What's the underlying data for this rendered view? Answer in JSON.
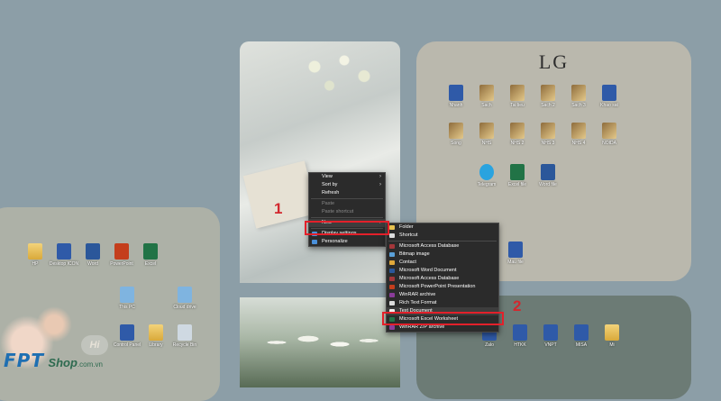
{
  "lg_panel": {
    "title": "LG"
  },
  "desktop_left": {
    "icons": [
      {
        "label": "HP",
        "type": "folder"
      },
      {
        "label": "Desktop ICON",
        "type": "app"
      },
      {
        "label": "Word",
        "type": "word"
      },
      {
        "label": "PowerPoint",
        "type": "ppt"
      },
      {
        "label": "Excel",
        "type": "excel"
      },
      {
        "label": "This PC",
        "type": "pc"
      },
      {
        "label": "Cloud drive",
        "type": "pc"
      },
      {
        "label": "Control Panel",
        "type": "app"
      },
      {
        "label": "Library",
        "type": "folder"
      },
      {
        "label": "Recycle Bin",
        "type": "bin"
      }
    ]
  },
  "desktop_lg": {
    "icons": [
      {
        "label": "Nhanh",
        "type": "app"
      },
      {
        "label": "Sach",
        "type": "book"
      },
      {
        "label": "Tai lieu",
        "type": "book"
      },
      {
        "label": "Sach 2",
        "type": "book"
      },
      {
        "label": "Sach 3",
        "type": "book"
      },
      {
        "label": "Khao sat",
        "type": "app"
      },
      {
        "label": "Song",
        "type": "book"
      },
      {
        "label": "NHS",
        "type": "book"
      },
      {
        "label": "NHS 2",
        "type": "book"
      },
      {
        "label": "NHS 3",
        "type": "book"
      },
      {
        "label": "NHS 4",
        "type": "book"
      },
      {
        "label": "NOIDA",
        "type": "book"
      },
      {
        "label": "Telegram",
        "type": "tg"
      },
      {
        "label": "Excel file",
        "type": "excel"
      },
      {
        "label": "Word file",
        "type": "word"
      },
      {
        "label": "Mau file",
        "type": "app"
      }
    ]
  },
  "desktop_br": {
    "icons": [
      {
        "label": "Zalo",
        "type": "app"
      },
      {
        "label": "HTKK",
        "type": "app"
      },
      {
        "label": "VNPT",
        "type": "app"
      },
      {
        "label": "MISA",
        "type": "app"
      },
      {
        "label": "Mi",
        "type": "folder"
      }
    ]
  },
  "context_menu": {
    "items": [
      {
        "label": "View",
        "icon": "",
        "submenu": true,
        "disabled": false
      },
      {
        "label": "Sort by",
        "icon": "",
        "submenu": true,
        "disabled": false
      },
      {
        "label": "Refresh",
        "icon": "",
        "submenu": false,
        "disabled": false
      },
      {
        "label": "Paste",
        "icon": "",
        "submenu": false,
        "disabled": true
      },
      {
        "label": "Paste shortcut",
        "icon": "",
        "submenu": false,
        "disabled": true
      },
      {
        "label": "New",
        "icon": "",
        "submenu": true,
        "disabled": false
      },
      {
        "label": "Display settings",
        "icon": "display-icon",
        "submenu": false,
        "disabled": false
      },
      {
        "label": "Personalize",
        "icon": "personalize-icon",
        "submenu": false,
        "disabled": false
      }
    ]
  },
  "submenu_new": {
    "items": [
      {
        "label": "Folder",
        "icon": "folder-icon",
        "color": "#e8c14f"
      },
      {
        "label": "Shortcut",
        "icon": "shortcut-icon",
        "color": "#dcdcdc"
      },
      {
        "label": "Microsoft Access Database",
        "icon": "access-icon",
        "color": "#a4373a"
      },
      {
        "label": "Bitmap image",
        "icon": "bitmap-icon",
        "color": "#5aa0d8"
      },
      {
        "label": "Contact",
        "icon": "contact-icon",
        "color": "#e0a83a"
      },
      {
        "label": "Microsoft Word Document",
        "icon": "word-icon",
        "color": "#2b579a"
      },
      {
        "label": "Microsoft Access Database",
        "icon": "access-icon",
        "color": "#a4373a"
      },
      {
        "label": "Microsoft PowerPoint Presentation",
        "icon": "ppt-icon",
        "color": "#c43e1c"
      },
      {
        "label": "WinRAR archive",
        "icon": "winrar-icon",
        "color": "#8a3c9a"
      },
      {
        "label": "Rich Text Format",
        "icon": "rtf-icon",
        "color": "#dcdcdc"
      },
      {
        "label": "Text Document",
        "icon": "text-icon",
        "color": "#f0f0f0"
      },
      {
        "label": "Microsoft Excel Worksheet",
        "icon": "excel-icon",
        "color": "#217346"
      },
      {
        "label": "WinRAR ZIP archive",
        "icon": "winrar-zip-icon",
        "color": "#8a3c9a"
      }
    ]
  },
  "annotations": {
    "step1": "1",
    "step2": "2"
  },
  "branding": {
    "logo": "FPT",
    "shop": "Shop",
    "domain": ".com.vn",
    "badge": "Hi"
  },
  "colors": {
    "highlight": "#e3202a",
    "menu_bg": "#2b2b2b"
  }
}
